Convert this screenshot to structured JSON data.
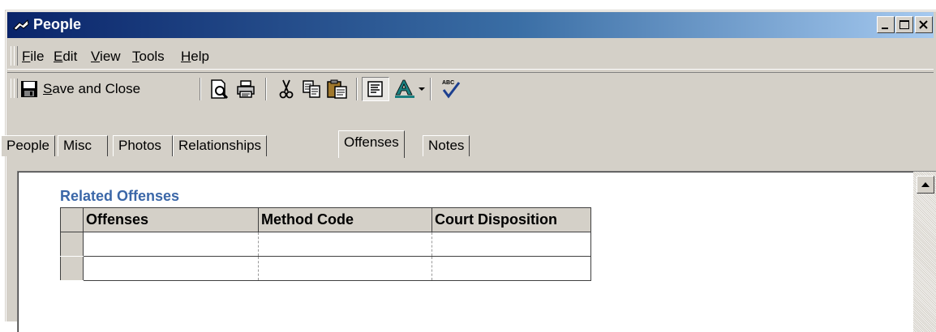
{
  "window": {
    "title": "People",
    "icon": "people-app-icon",
    "caption_buttons": [
      "minimize-icon",
      "maximize-icon",
      "close-icon"
    ]
  },
  "menu": {
    "items": [
      {
        "label": "File",
        "accel": "F",
        "rest": "ile"
      },
      {
        "label": "Edit",
        "accel": "E",
        "rest": "dit"
      },
      {
        "label": "View",
        "accel": "V",
        "rest": "iew"
      },
      {
        "label": "Tools",
        "accel": "T",
        "rest": "ools"
      },
      {
        "label": "Help",
        "accel": "H",
        "rest": "elp"
      }
    ]
  },
  "toolbar": {
    "save_close": {
      "label": "Save and Close",
      "accel": "S",
      "rest": "ave and Close",
      "icon": "floppy-disk-icon"
    },
    "icons": [
      "print-preview-icon",
      "printer-icon",
      "cut-icon",
      "copy-icon",
      "paste-icon",
      "text-format-icon",
      "font-color-icon",
      "dropdown-arrow-icon",
      "spell-check-icon"
    ]
  },
  "tabs": [
    {
      "label": "People",
      "active": false
    },
    {
      "label": "Misc",
      "active": false
    },
    {
      "label": "Photos",
      "active": false
    },
    {
      "label": "Relationships",
      "active": false
    },
    {
      "label": "Offenses",
      "active": true
    },
    {
      "label": "Notes",
      "active": false
    }
  ],
  "content": {
    "section_title": "Related Offenses",
    "grid": {
      "columns": [
        "Offenses",
        "Method Code",
        "Court Disposition"
      ],
      "rows": [
        [
          "",
          "",
          ""
        ],
        [
          "",
          "",
          ""
        ]
      ]
    }
  },
  "colors": {
    "title_gradient_start": "#0a246a",
    "title_gradient_end": "#a6caf0",
    "section_title": "#3b67a8",
    "face": "#d4d0c8"
  }
}
